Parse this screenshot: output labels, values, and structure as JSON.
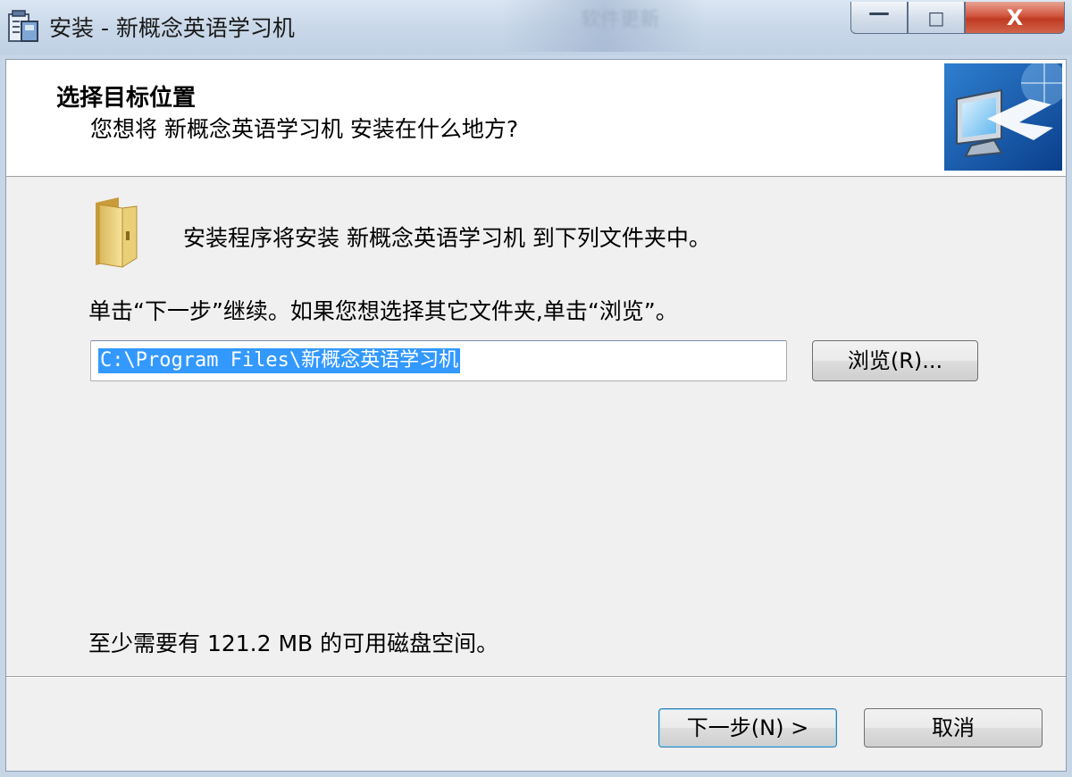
{
  "window": {
    "title": "安装 - 新概念英语学习机",
    "background_blur_text": "软件更新",
    "controls": {
      "minimize": "—",
      "maximize": "□",
      "close": "X"
    }
  },
  "header": {
    "title": "选择目标位置",
    "subtitle": "您想将 新概念英语学习机 安装在什么地方?"
  },
  "body": {
    "install_message": "安装程序将安装 新概念英语学习机 到下列文件夹中。",
    "hint": "单击“下一步”继续。如果您想选择其它文件夹,单击“浏览”。",
    "install_path": "C:\\Program Files\\新概念英语学习机",
    "browse_label": "浏览(R)...",
    "disk_space": "至少需要有 121.2 MB 的可用磁盘空间。"
  },
  "footer": {
    "next_label": "下一步(N) >",
    "cancel_label": "取消"
  },
  "colors": {
    "selection": "#3399ff",
    "close_button": "#c13a22",
    "dialog_bg": "#f0f0f0"
  },
  "icons": [
    "setup-app-icon",
    "minimize-icon",
    "maximize-icon",
    "close-icon",
    "wizard-monitor-icon",
    "folder-icon"
  ]
}
